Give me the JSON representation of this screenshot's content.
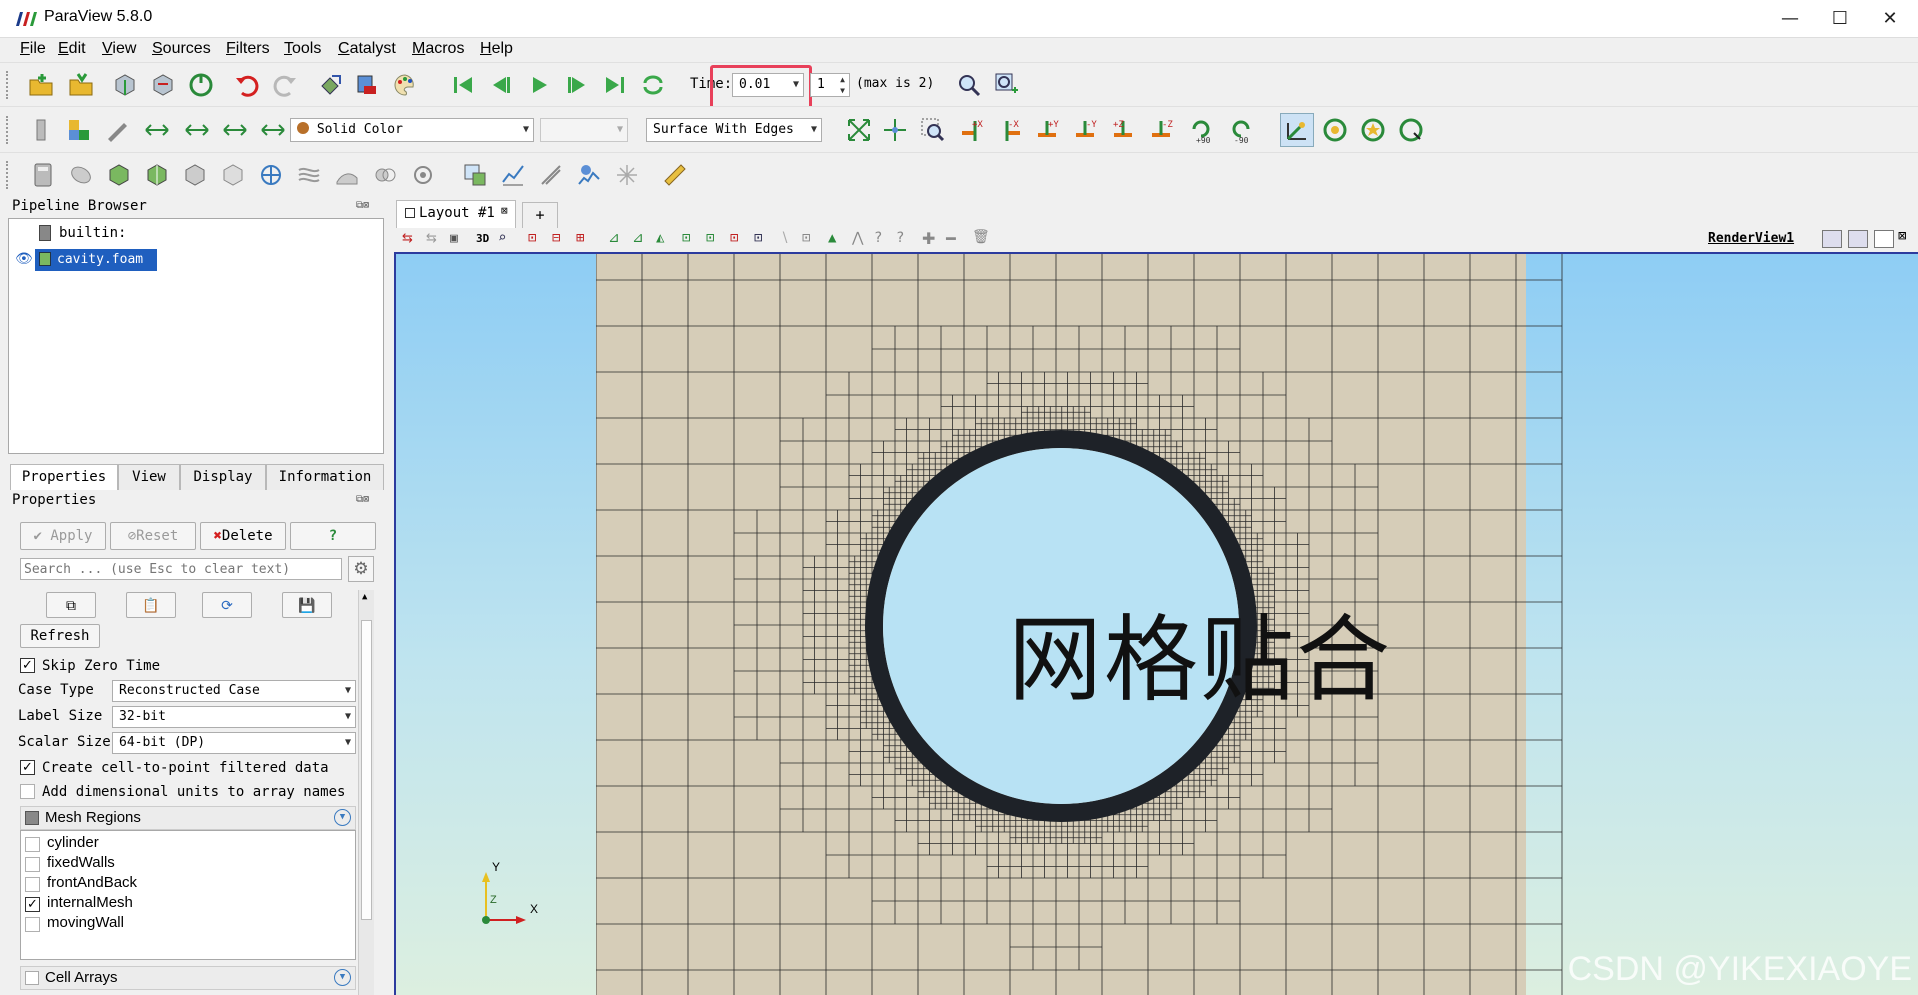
{
  "app": {
    "title": "ParaView 5.8.0"
  },
  "window_controls": {
    "minimize": "—",
    "maximize": "☐",
    "close": "✕"
  },
  "menu": [
    "File",
    "Edit",
    "View",
    "Sources",
    "Filters",
    "Tools",
    "Catalyst",
    "Macros",
    "Help"
  ],
  "time_controls": {
    "label": "Time:",
    "time_value": "0.01",
    "step_value": "1",
    "max_label": "(max is 2)"
  },
  "representation": {
    "coloring": "Solid Color",
    "style": "Surface With Edges"
  },
  "pipeline_browser": {
    "title": "Pipeline Browser",
    "builtin": "builtin:",
    "source": "cavity.foam"
  },
  "tabs": [
    "Properties",
    "View",
    "Display",
    "Information"
  ],
  "properties": {
    "title": "Properties",
    "apply": "Apply",
    "reset": "Reset",
    "delete": "Delete",
    "help": "?",
    "search_placeholder": "Search ... (use Esc to clear text)",
    "refresh": "Refresh",
    "skip_zero_time": "Skip Zero Time",
    "case_type_label": "Case Type",
    "case_type_value": "Reconstructed Case",
    "label_size_label": "Label Size",
    "label_size_value": "32-bit",
    "scalar_size_label": "Scalar Size",
    "scalar_size_value": "64-bit (DP)",
    "cell_to_point": "Create cell-to-point filtered data",
    "dimensional_units": "Add dimensional units to array names",
    "mesh_regions_title": "Mesh Regions",
    "mesh_regions": [
      {
        "name": "cylinder",
        "checked": false
      },
      {
        "name": "fixedWalls",
        "checked": false
      },
      {
        "name": "frontAndBack",
        "checked": false
      },
      {
        "name": "internalMesh",
        "checked": true
      },
      {
        "name": "movingWall",
        "checked": false
      }
    ],
    "cell_arrays_title": "Cell Arrays"
  },
  "layout": {
    "tab_label": "Layout #1",
    "add_tab": "+",
    "view_name": "RenderView1",
    "mode_3d": "3D"
  },
  "render": {
    "overlay_text": "网格贴合",
    "axis_y": "Y",
    "axis_x": "X",
    "axis_z": "Z",
    "watermark": "CSDN @YIKEXIAOYE"
  },
  "colors": {
    "highlight": "#e8405a",
    "selection": "#1f5fbf",
    "view_border": "#2c3b9e",
    "mesh_fill": "#d6cdb8",
    "mesh_edge": "#2a2a2a"
  }
}
